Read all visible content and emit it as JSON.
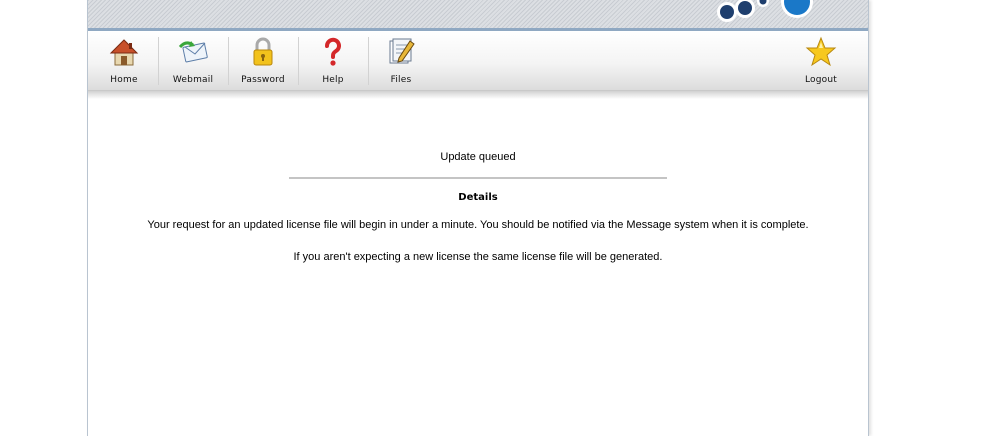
{
  "nav": {
    "items": [
      {
        "label": "Home",
        "icon": "home-icon"
      },
      {
        "label": "Webmail",
        "icon": "webmail-icon"
      },
      {
        "label": "Password",
        "icon": "padlock-icon"
      },
      {
        "label": "Help",
        "icon": "question-mark-icon"
      },
      {
        "label": "Files",
        "icon": "files-icon"
      },
      {
        "label": "Logout",
        "icon": "star-icon"
      }
    ]
  },
  "main": {
    "status": "Update queued",
    "details_title": "Details",
    "message_1": "Your request for an updated license file will begin in under a minute. You should be notified via the Message system when it is complete.",
    "message_2": "If you aren't expecting a new license the same license file will be generated."
  },
  "colors": {
    "banner_border": "#8fa8c2",
    "logo_blue": "#1a78c8",
    "logo_dark": "#1f3f6e"
  }
}
